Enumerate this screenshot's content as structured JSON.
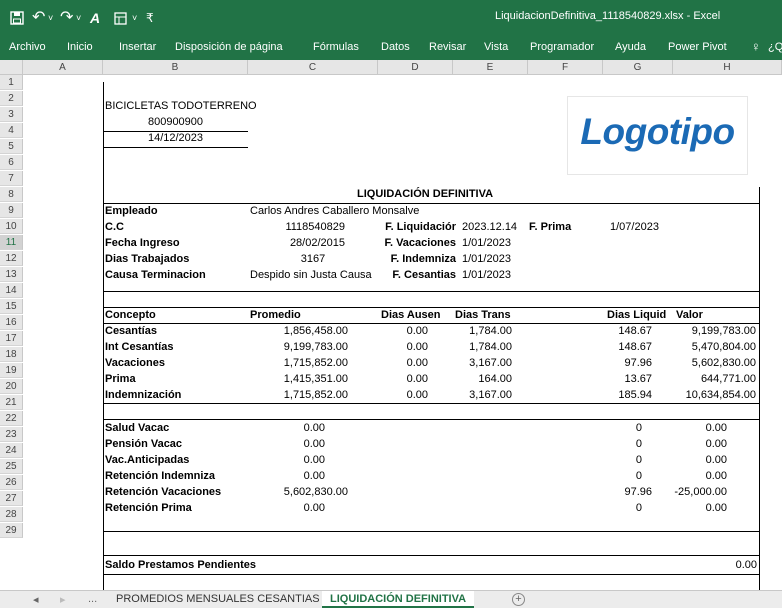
{
  "window": {
    "file_title": "LiquidacionDefinitiva_1118540829.xlsx  -  Excel",
    "quick_access": [
      "save-icon",
      "undo-icon",
      "redo-icon",
      "spelling-icon",
      "format-icon",
      "customize-icon"
    ]
  },
  "ribbon_tabs": [
    "Archivo",
    "Inicio",
    "Insertar",
    "Disposición de página",
    "Fórmulas",
    "Datos",
    "Revisar",
    "Vista",
    "Programador",
    "Ayuda",
    "Power Pivot",
    "¿Q"
  ],
  "columns": [
    "A",
    "B",
    "C",
    "D",
    "E",
    "F",
    "G",
    "H"
  ],
  "rows": [
    "1",
    "2",
    "3",
    "4",
    "5",
    "6",
    "7",
    "8",
    "9",
    "10",
    "11",
    "12",
    "13",
    "14",
    "15",
    "16",
    "17",
    "18",
    "19",
    "20",
    "21",
    "22",
    "23",
    "24",
    "25",
    "26",
    "27",
    "28",
    "29"
  ],
  "company": {
    "name": "BICICLETAS TODOTERRENO",
    "nit": "800900900",
    "date": "14/12/2023"
  },
  "logo_text": "Logotipo",
  "title": "LIQUIDACIÓN DEFINITIVA",
  "info": {
    "empleado_label": "Empleado",
    "empleado": "Carlos Andres  Caballero Monsalve",
    "cc_label": "C.C",
    "cc": "1118540829",
    "fliq_label": "F. Liquidaciór",
    "fliq": "2023.12.14",
    "fprima_label": "F. Prima",
    "fprima": "1/07/2023",
    "fingreso_label": "Fecha Ingreso",
    "fingreso": "28/02/2015",
    "fvac_label": "F. Vacaciones",
    "fvac": "1/01/2023",
    "dias_label": "Dias Trabajados",
    "dias": "3167",
    "find_label": "F. Indemniza",
    "find": "1/01/2023",
    "causa_label": "Causa Terminacion",
    "causa": "Despido sin Justa Causa",
    "fces_label": "F. Cesantias",
    "fces": "1/01/2023"
  },
  "table": {
    "headers": {
      "concepto": "Concepto",
      "promedio": "Promedio",
      "ausen": "Dias Ausen",
      "trans": "Dias Trans",
      "liquid": "Dias Liquid",
      "valor": "Valor"
    },
    "rows": [
      {
        "concepto": "Cesantías",
        "promedio": "1,856,458.00",
        "ausen": "0.00",
        "trans": "1,784.00",
        "liquid": "148.67",
        "valor": "9,199,783.00"
      },
      {
        "concepto": "Int Cesantías",
        "promedio": "9,199,783.00",
        "ausen": "0.00",
        "trans": "1,784.00",
        "liquid": "148.67",
        "valor": "5,470,804.00"
      },
      {
        "concepto": "Vacaciones",
        "promedio": "1,715,852.00",
        "ausen": "0.00",
        "trans": "3,167.00",
        "liquid": "97.96",
        "valor": "5,602,830.00"
      },
      {
        "concepto": "Prima",
        "promedio": "1,415,351.00",
        "ausen": "0.00",
        "trans": "164.00",
        "liquid": "13.67",
        "valor": "644,771.00"
      },
      {
        "concepto": "Indemnización",
        "promedio": "1,715,852.00",
        "ausen": "0.00",
        "trans": "3,167.00",
        "liquid": "185.94",
        "valor": "10,634,854.00"
      }
    ]
  },
  "deductions": [
    {
      "label": "Salud Vacac",
      "promedio": "0.00",
      "liquid": "0",
      "valor": "0.00"
    },
    {
      "label": "Pensión Vacac",
      "promedio": "0.00",
      "liquid": "0",
      "valor": "0.00"
    },
    {
      "label": "Vac.Anticipadas",
      "promedio": "0.00",
      "liquid": "0",
      "valor": "0.00"
    },
    {
      "label": "Retención Indemniza",
      "promedio": "0.00",
      "liquid": "0",
      "valor": "0.00"
    },
    {
      "label": "Retención Vacaciones",
      "promedio": "5,602,830.00",
      "liquid": "97.96",
      "valor": "-25,000.00"
    },
    {
      "label": "Retención Prima",
      "promedio": "0.00",
      "liquid": "0",
      "valor": "0.00"
    }
  ],
  "saldo": {
    "label": "Saldo Prestamos Pendientes",
    "value": "0.00"
  },
  "sheet_tabs": {
    "ellipsis": "...",
    "tab1": "PROMEDIOS MENSUALES CESANTIAS",
    "tab2": "LIQUIDACIÓN DEFINITIVA",
    "add": "+"
  }
}
